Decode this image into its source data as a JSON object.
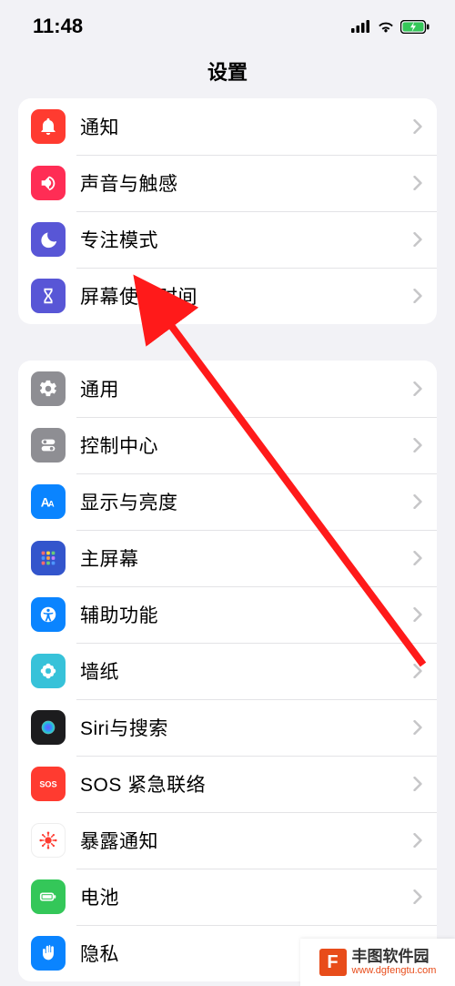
{
  "status": {
    "time": "11:48"
  },
  "title": "设置",
  "groups": [
    {
      "rows": [
        {
          "name": "notifications",
          "icon": "bell-icon",
          "color": "#ff3b30",
          "label": "通知"
        },
        {
          "name": "sounds",
          "icon": "speaker-icon",
          "color": "#ff2d55",
          "label": "声音与触感"
        },
        {
          "name": "focus",
          "icon": "moon-icon",
          "color": "#5856d6",
          "label": "专注模式"
        },
        {
          "name": "screen-time",
          "icon": "hourglass-icon",
          "color": "#5856d6",
          "label": "屏幕使用时间"
        }
      ]
    },
    {
      "rows": [
        {
          "name": "general",
          "icon": "gear-icon",
          "color": "#8e8e93",
          "label": "通用"
        },
        {
          "name": "control-center",
          "icon": "switches-icon",
          "color": "#8e8e93",
          "label": "控制中心"
        },
        {
          "name": "display",
          "icon": "text-size-icon",
          "color": "#0a84ff",
          "label": "显示与亮度"
        },
        {
          "name": "home-screen",
          "icon": "grid-icon",
          "color": "#3355cc",
          "label": "主屏幕"
        },
        {
          "name": "accessibility",
          "icon": "accessibility-icon",
          "color": "#0a84ff",
          "label": "辅助功能"
        },
        {
          "name": "wallpaper",
          "icon": "flower-icon",
          "color": "#37c2d9",
          "label": "墙纸"
        },
        {
          "name": "siri",
          "icon": "siri-icon",
          "color": "#1c1c1e",
          "label": "Siri与搜索"
        },
        {
          "name": "sos",
          "icon": "sos-icon",
          "color": "#ff3b30",
          "label": "SOS 紧急联络"
        },
        {
          "name": "exposure",
          "icon": "virus-icon",
          "color": "#ffffff",
          "label": "暴露通知"
        },
        {
          "name": "battery",
          "icon": "battery-icon",
          "color": "#34c759",
          "label": "电池"
        },
        {
          "name": "privacy",
          "icon": "hand-icon",
          "color": "#0a84ff",
          "label": "隐私"
        }
      ]
    }
  ],
  "annotation": {
    "arrow_color": "#ff1a1a"
  },
  "watermark": {
    "name": "丰图软件园",
    "url": "www.dgfengtu.com"
  }
}
